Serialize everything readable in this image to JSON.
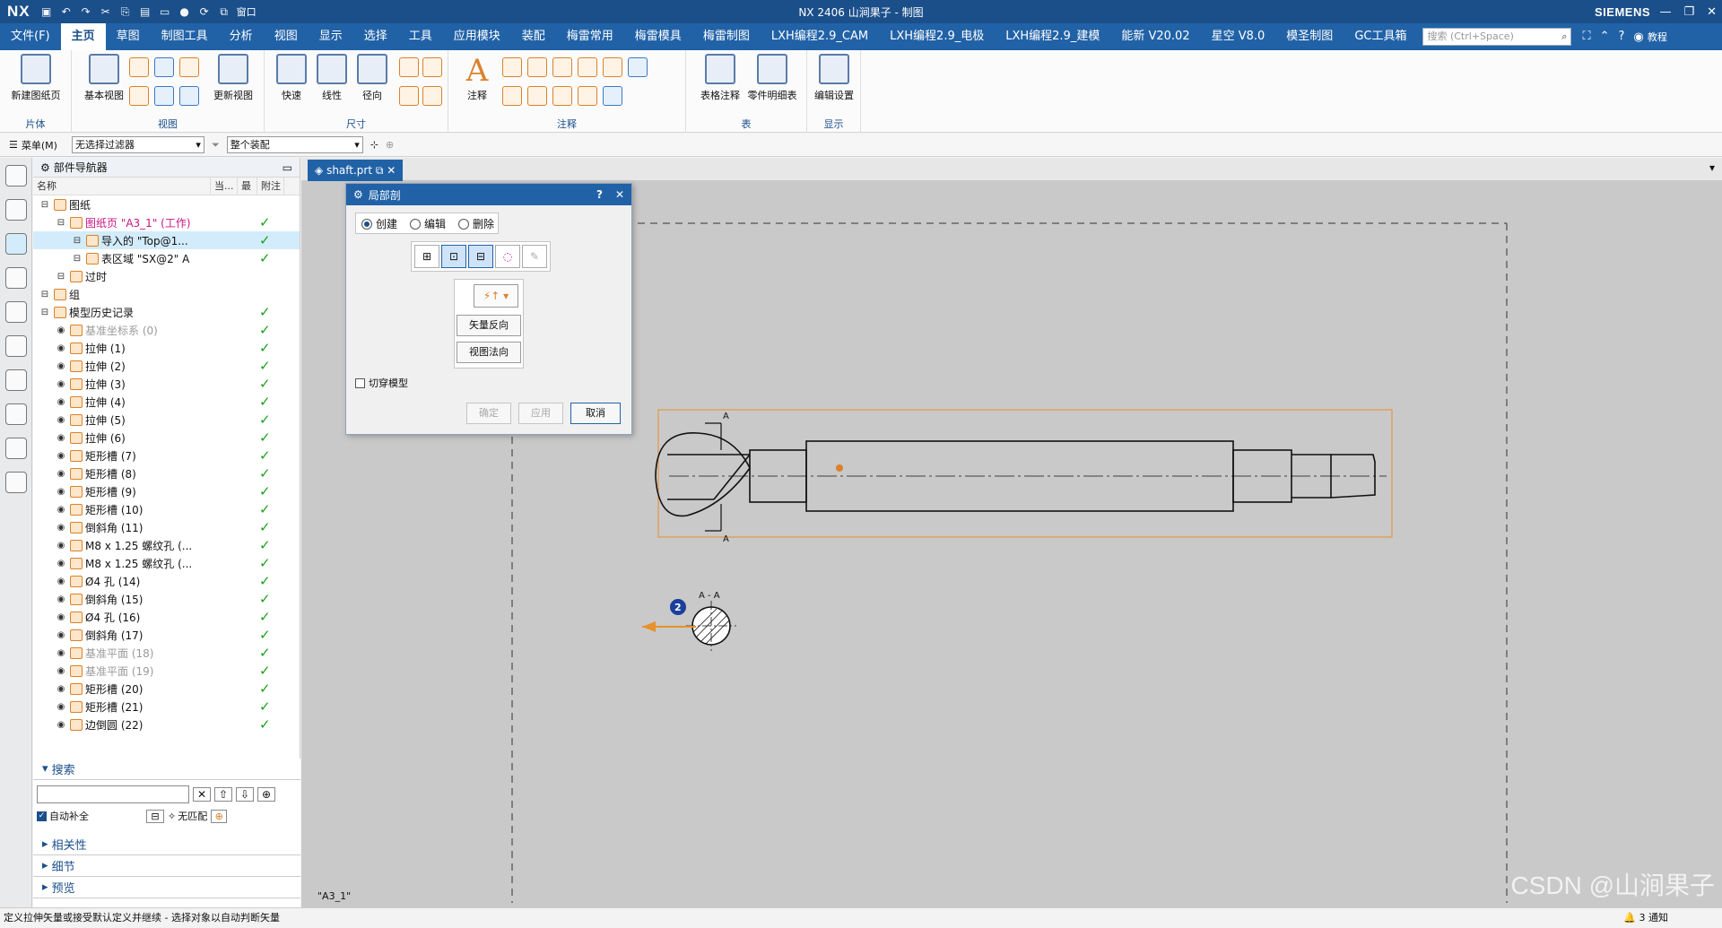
{
  "titlebar": {
    "logo": "NX",
    "center": "NX 2406 山涧果子 - 制图",
    "brand": "SIEMENS",
    "window_menu": "窗口"
  },
  "menu": {
    "items": [
      "文件(F)",
      "主页",
      "草图",
      "制图工具",
      "分析",
      "视图",
      "显示",
      "选择",
      "工具",
      "应用模块",
      "装配",
      "梅雷常用",
      "梅雷模具",
      "梅雷制图",
      "LXH编程2.9_CAM",
      "LXH编程2.9_电极",
      "LXH编程2.9_建模",
      "能新 V20.02",
      "星空 V8.0",
      "模圣制图",
      "GC工具箱"
    ],
    "active": "主页",
    "search_placeholder": "搜索 (Ctrl+Space)",
    "tutorial": "教程"
  },
  "ribbon": {
    "sheet": {
      "button": "新建图纸页",
      "group": "片体"
    },
    "view": {
      "buttons": [
        "基本视图",
        "更新视图"
      ],
      "group": "视图"
    },
    "dimension": {
      "buttons": [
        "快速",
        "线性",
        "径向"
      ],
      "group": "尺寸"
    },
    "annotation": {
      "buttons": [
        "注释"
      ],
      "group": "注释"
    },
    "table": {
      "buttons": [
        "表格注释",
        "零件明细表"
      ],
      "group": "表"
    },
    "display": {
      "buttons": [
        "编辑设置"
      ],
      "group": "显示"
    }
  },
  "filterbar": {
    "menu": "菜单(M)",
    "filter": "无选择过滤器",
    "assembly": "整个装配"
  },
  "navigator": {
    "title": "部件导航器",
    "columns": [
      "名称",
      "当...",
      "最",
      "附注"
    ],
    "rows": [
      {
        "label": "图纸",
        "level": 0,
        "check": false
      },
      {
        "label": "图纸页 \"A3_1\" (工作)",
        "level": 1,
        "check": true,
        "style": "pink"
      },
      {
        "label": "导入的 \"Top@1...",
        "level": 2,
        "check": true,
        "style": "sel"
      },
      {
        "label": "表区域 \"SX@2\" A",
        "level": 2,
        "check": true
      },
      {
        "label": "过时",
        "level": 1,
        "check": false
      },
      {
        "label": "组",
        "level": 0,
        "check": false
      },
      {
        "label": "模型历史记录",
        "level": 0,
        "check": true
      },
      {
        "label": "基准坐标系 (0)",
        "level": 1,
        "check": true,
        "style": "dim"
      },
      {
        "label": "拉伸 (1)",
        "level": 1,
        "check": true
      },
      {
        "label": "拉伸 (2)",
        "level": 1,
        "check": true
      },
      {
        "label": "拉伸 (3)",
        "level": 1,
        "check": true
      },
      {
        "label": "拉伸 (4)",
        "level": 1,
        "check": true
      },
      {
        "label": "拉伸 (5)",
        "level": 1,
        "check": true
      },
      {
        "label": "拉伸 (6)",
        "level": 1,
        "check": true
      },
      {
        "label": "矩形槽 (7)",
        "level": 1,
        "check": true
      },
      {
        "label": "矩形槽 (8)",
        "level": 1,
        "check": true
      },
      {
        "label": "矩形槽 (9)",
        "level": 1,
        "check": true
      },
      {
        "label": "矩形槽 (10)",
        "level": 1,
        "check": true
      },
      {
        "label": "倒斜角 (11)",
        "level": 1,
        "check": true
      },
      {
        "label": "M8 x 1.25 螺纹孔 (...",
        "level": 1,
        "check": true
      },
      {
        "label": "M8 x 1.25 螺纹孔 (...",
        "level": 1,
        "check": true
      },
      {
        "label": "Ø4 孔 (14)",
        "level": 1,
        "check": true
      },
      {
        "label": "倒斜角 (15)",
        "level": 1,
        "check": true
      },
      {
        "label": "Ø4 孔 (16)",
        "level": 1,
        "check": true
      },
      {
        "label": "倒斜角 (17)",
        "level": 1,
        "check": true
      },
      {
        "label": "基准平面 (18)",
        "level": 1,
        "check": true,
        "style": "dim"
      },
      {
        "label": "基准平面 (19)",
        "level": 1,
        "check": true,
        "style": "dim"
      },
      {
        "label": "矩形槽 (20)",
        "level": 1,
        "check": true
      },
      {
        "label": "矩形槽 (21)",
        "level": 1,
        "check": true
      },
      {
        "label": "边倒圆 (22)",
        "level": 1,
        "check": true
      }
    ],
    "search": {
      "title": "搜索",
      "autocomplete": "自动补全",
      "nomatch": "无匹配"
    },
    "sections": [
      "相关性",
      "细节",
      "预览"
    ]
  },
  "tab": {
    "label": "shaft.prt"
  },
  "dialog": {
    "title": "局部剖",
    "options": [
      "创建",
      "编辑",
      "删除"
    ],
    "selected": "创建",
    "vector_reverse": "矢量反向",
    "view_normal": "视图法向",
    "cut_model": "切穿模型",
    "ok": "确定",
    "apply": "应用",
    "cancel": "取消"
  },
  "drawing": {
    "sheet_name": "\"A3_1\"",
    "section_label": "A - A",
    "cut_letter": "A",
    "marker": "2"
  },
  "watermark": "CSDN @山涧果子",
  "status": {
    "prompt": "定义拉伸矢量或接受默认定义并继续 - 选择对象以自动判断矢量",
    "notifications": "3 通知"
  }
}
